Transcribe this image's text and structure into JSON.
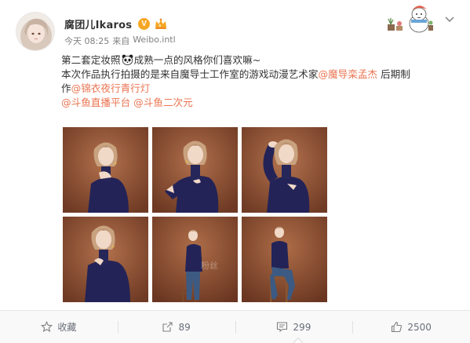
{
  "post": {
    "username": "腐团儿Ikaros",
    "verified_badge": "V",
    "vip_icon": "vip-crown-icon",
    "timestamp": "今天 08:25",
    "source_prefix": "来自",
    "source": "Weibo.intl",
    "text": {
      "line1_a": "第二套定妆照",
      "line1_emoji": "panda-emoji",
      "line1_b": "成熟一点的风格你们喜欢嘛~",
      "line2_a": "本次作品执行拍摄的是来自魔导士工作室的游戏动漫艺术家",
      "line2_mention": "@魔导栾孟杰",
      "line2_b": " 后期制",
      "line3_a": "作",
      "line3_mention": "@锦衣夜行青行灯",
      "line4_mention1": "@斗鱼直播平台",
      "line4_mention2": "@斗鱼二次元"
    },
    "photo_count": 6
  },
  "actions": {
    "favorite_label": "收藏",
    "repost_count": "89",
    "comment_count": "299",
    "like_count": "2500"
  },
  "colors": {
    "mention": "#eb7350",
    "badge": "#f5a623",
    "photo_bg": "#8a4f32",
    "sweater": "#232357"
  }
}
